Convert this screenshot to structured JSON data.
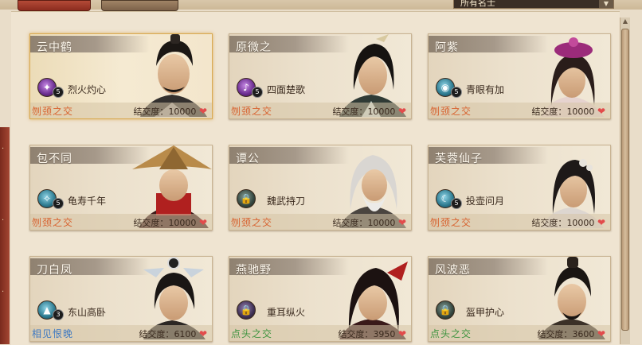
{
  "filter": {
    "selected": "所有名士"
  },
  "affinity_label": "结交度：",
  "colors": {
    "accent": "#d9a94f",
    "relation_close": "#d8622f",
    "relation_high": "#3e79c2",
    "relation_green": "#3f9440"
  },
  "cards": [
    {
      "name": "云中鹤",
      "skill": "烈火灼心",
      "level": "5",
      "icon": "fire-skill-icon",
      "relation": "刎颈之交",
      "relation_color": "#d8622f",
      "affinity": "10000"
    },
    {
      "name": "原微之",
      "skill": "四面楚歌",
      "level": "5",
      "icon": "song-skill-icon",
      "relation": "刎颈之交",
      "relation_color": "#d8622f",
      "affinity": "10000"
    },
    {
      "name": "阿紫",
      "skill": "青眼有加",
      "level": "5",
      "icon": "eye-skill-icon",
      "relation": "刎颈之交",
      "relation_color": "#d8622f",
      "affinity": "10000"
    },
    {
      "name": "包不同",
      "skill": "龟寿千年",
      "level": "5",
      "icon": "turtle-skill-icon",
      "relation": "刎颈之交",
      "relation_color": "#d8622f",
      "affinity": "10000"
    },
    {
      "name": "谭公",
      "skill": "魏武持刀",
      "level": "",
      "icon": "lock-icon",
      "relation": "刎颈之交",
      "relation_color": "#d8622f",
      "affinity": "10000"
    },
    {
      "name": "芙蓉仙子",
      "skill": "投壶问月",
      "level": "5",
      "icon": "moon-skill-icon",
      "relation": "刎颈之交",
      "relation_color": "#d8622f",
      "affinity": "10000"
    },
    {
      "name": "刀白凤",
      "skill": "东山高卧",
      "level": "3",
      "icon": "mountain-skill-icon",
      "relation": "相见恨晚",
      "relation_color": "#3e79c2",
      "affinity": "6100"
    },
    {
      "name": "燕驰野",
      "skill": "重耳纵火",
      "level": "",
      "icon": "lock-icon",
      "relation": "点头之交",
      "relation_color": "#3f9440",
      "affinity": "3950"
    },
    {
      "name": "风波恶",
      "skill": "盔甲护心",
      "level": "",
      "icon": "lock-icon",
      "relation": "点头之交",
      "relation_color": "#3f9440",
      "affinity": "3600"
    }
  ]
}
